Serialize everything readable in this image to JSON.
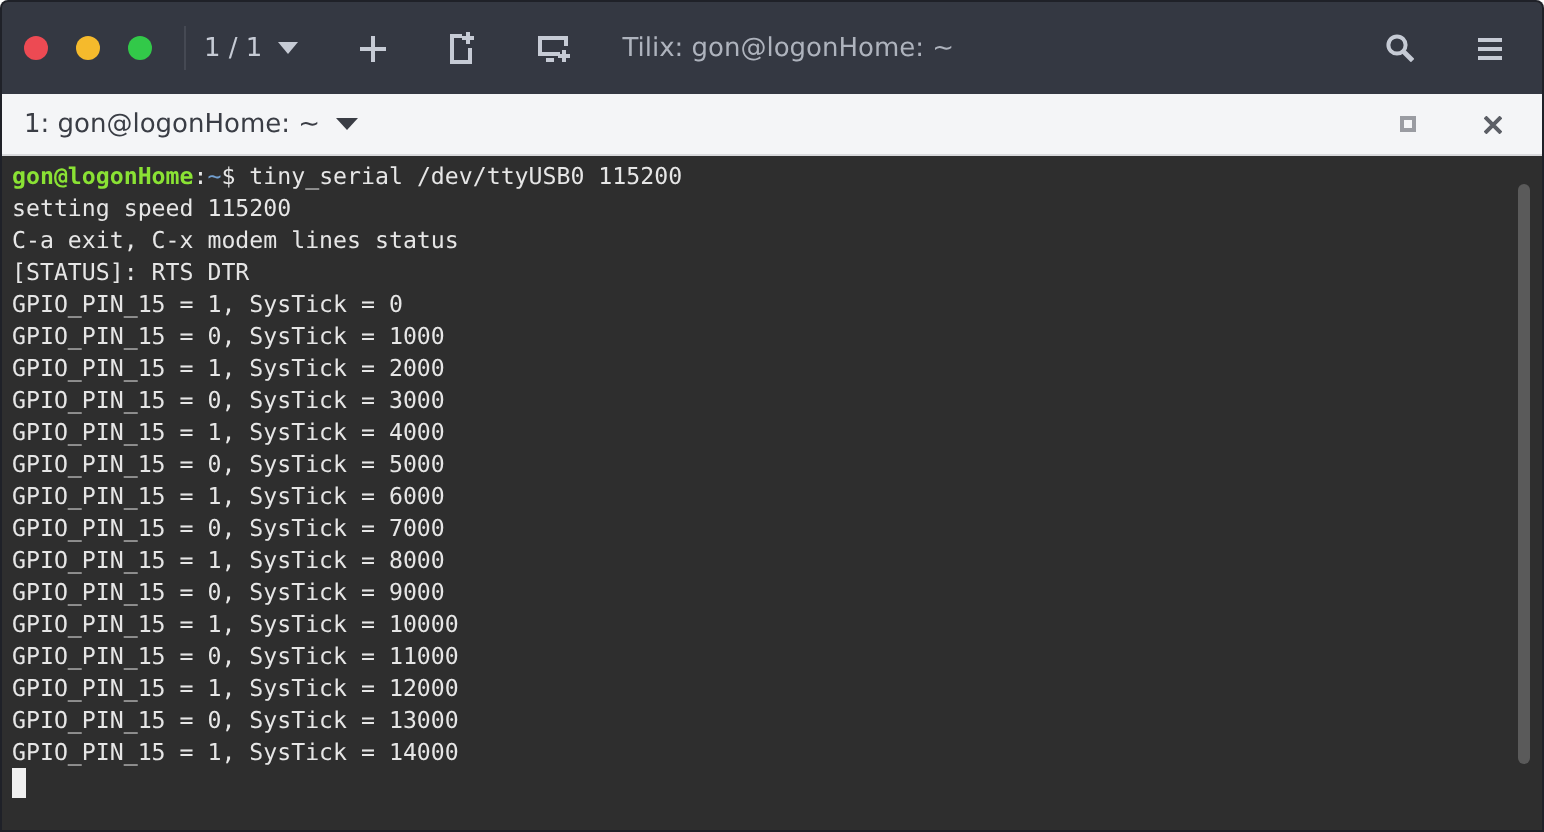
{
  "header": {
    "session_counter": "1 / 1",
    "title": "Tilix: gon@logonHome: ~"
  },
  "tab": {
    "label": "1: gon@logonHome: ~"
  },
  "terminal": {
    "prompt": {
      "user_host": "gon@logonHome",
      "separator": ":",
      "path": "~",
      "symbol": "$",
      "command": "tiny_serial /dev/ttyUSB0 115200"
    },
    "lines": [
      "setting speed 115200",
      "C-a exit, C-x modem lines status",
      "[STATUS]: RTS DTR",
      "GPIO_PIN_15 = 1, SysTick = 0",
      "GPIO_PIN_15 = 0, SysTick = 1000",
      "GPIO_PIN_15 = 1, SysTick = 2000",
      "GPIO_PIN_15 = 0, SysTick = 3000",
      "GPIO_PIN_15 = 1, SysTick = 4000",
      "GPIO_PIN_15 = 0, SysTick = 5000",
      "GPIO_PIN_15 = 1, SysTick = 6000",
      "GPIO_PIN_15 = 0, SysTick = 7000",
      "GPIO_PIN_15 = 1, SysTick = 8000",
      "GPIO_PIN_15 = 0, SysTick = 9000",
      "GPIO_PIN_15 = 1, SysTick = 10000",
      "GPIO_PIN_15 = 0, SysTick = 11000",
      "GPIO_PIN_15 = 1, SysTick = 12000",
      "GPIO_PIN_15 = 0, SysTick = 13000",
      "GPIO_PIN_15 = 1, SysTick = 14000"
    ]
  }
}
